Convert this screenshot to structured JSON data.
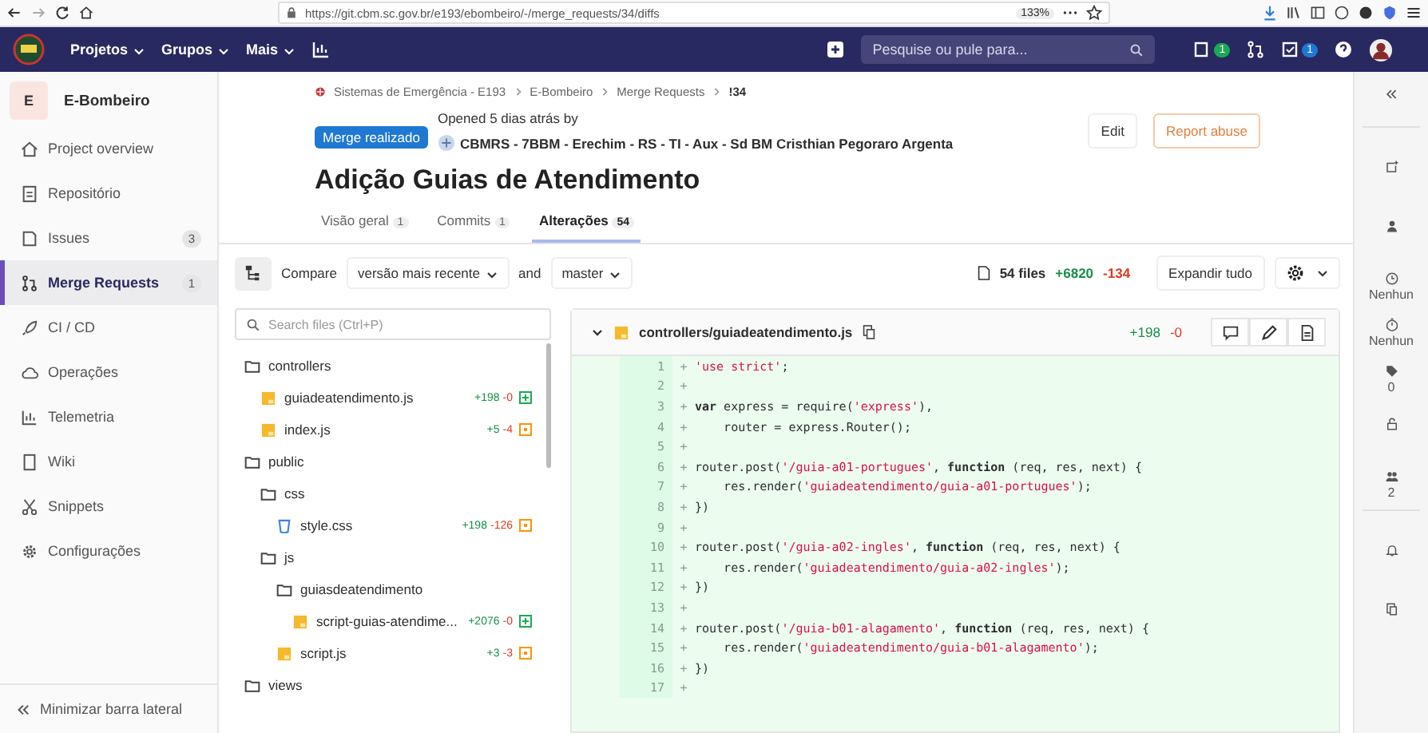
{
  "browser": {
    "url": "https://git.cbm.sc.gov.br/e193/ebombeiro/-/merge_requests/34/diffs",
    "zoom": "133%"
  },
  "navbar": {
    "menus": [
      "Projetos",
      "Grupos",
      "Mais"
    ],
    "search_placeholder": "Pesquise ou pule para...",
    "issues_count": "1",
    "todos_count": "1"
  },
  "sidebar": {
    "project_letter": "E",
    "project_name": "E-Bombeiro",
    "items": [
      {
        "label": "Project overview",
        "selected": false
      },
      {
        "label": "Repositório",
        "selected": false
      },
      {
        "label": "Issues",
        "count": "3",
        "selected": false
      },
      {
        "label": "Merge Requests",
        "count": "1",
        "selected": true
      },
      {
        "label": "CI / CD",
        "selected": false
      },
      {
        "label": "Operações",
        "selected": false
      },
      {
        "label": "Telemetria",
        "selected": false
      },
      {
        "label": "Wiki",
        "selected": false
      },
      {
        "label": "Snippets",
        "selected": false
      },
      {
        "label": "Configurações",
        "selected": false
      }
    ],
    "collapse_label": "Minimizar barra lateral"
  },
  "breadcrumb": [
    "Sistemas de Emergência - E193",
    "E-Bombeiro",
    "Merge Requests",
    "!34"
  ],
  "merge_request": {
    "status": "Merge realizado",
    "opened": "Opened 5 dias atrás by",
    "author": "CBMRS - 7BBM - Erechim - RS - TI - Aux - Sd BM Cristhian Pegoraro Argenta",
    "title": "Adição Guias de Atendimento",
    "actions": [
      {
        "label": "Edit",
        "kind": "default"
      },
      {
        "label": "Report abuse",
        "kind": "warning"
      }
    ]
  },
  "tabs": [
    {
      "label": "Visão geral",
      "count": "1",
      "selected": false
    },
    {
      "label": "Commits",
      "count": "1",
      "selected": false
    },
    {
      "label": "Alterações",
      "count": "54",
      "selected": true
    }
  ],
  "compare": {
    "label": "Compare",
    "source": "versão mais recente",
    "joiner": "and",
    "target": "master"
  },
  "stats": {
    "files": "54 files",
    "added": "+6820",
    "removed": "-134"
  },
  "expand_label": "Expandir tudo",
  "file_tree": {
    "search_placeholder": "Search files (Ctrl+P)",
    "items": [
      {
        "name": "controllers",
        "kind": "folder",
        "children": [
          {
            "name": "guiadeatendimento.js",
            "kind": "js",
            "added": "+198",
            "removed": "-0",
            "new_file": true
          },
          {
            "name": "index.js",
            "kind": "js",
            "added": "+5",
            "removed": "-4",
            "new_file": false
          }
        ]
      },
      {
        "name": "public",
        "kind": "folder",
        "children": [
          {
            "name": "css",
            "kind": "folder",
            "children": [
              {
                "name": "style.css",
                "kind": "css",
                "added": "+198",
                "removed": "-126",
                "new_file": false
              }
            ]
          },
          {
            "name": "js",
            "kind": "folder",
            "children": [
              {
                "name": "guiasdeatendimento",
                "kind": "folder",
                "children": [
                  {
                    "name": "script-guias-atendime...",
                    "kind": "js",
                    "added": "+2076",
                    "removed": "-0",
                    "new_file": true
                  }
                ]
              },
              {
                "name": "script.js",
                "kind": "js",
                "added": "+3",
                "removed": "-3",
                "new_file": false
              }
            ]
          }
        ]
      },
      {
        "name": "views",
        "kind": "folder"
      }
    ]
  },
  "diff": {
    "path": "controllers/guiadeatendimento.js",
    "added": "+198",
    "removed": "-0",
    "lines": [
      {
        "num": "1",
        "marker": "+",
        "tokens": [
          {
            "kind": "string",
            "text": "'use strict'"
          },
          {
            "kind": "plain",
            "text": ";"
          }
        ]
      },
      {
        "num": "2",
        "marker": "+"
      },
      {
        "num": "3",
        "marker": "+",
        "tokens": [
          {
            "kind": "keyword",
            "text": "var"
          },
          {
            "kind": "plain",
            "text": " express = require("
          },
          {
            "kind": "string",
            "text": "'express'"
          },
          {
            "kind": "plain",
            "text": "),"
          }
        ]
      },
      {
        "num": "4",
        "marker": "+",
        "tokens": [
          {
            "kind": "plain",
            "text": "    router = express.Router();"
          }
        ]
      },
      {
        "num": "5",
        "marker": "+"
      },
      {
        "num": "6",
        "marker": "+",
        "tokens": [
          {
            "kind": "plain",
            "text": "router.post("
          },
          {
            "kind": "string",
            "text": "'/guia-a01-portugues'"
          },
          {
            "kind": "plain",
            "text": ", "
          },
          {
            "kind": "keyword",
            "text": "function"
          },
          {
            "kind": "plain",
            "text": " (req, res, next) {"
          }
        ]
      },
      {
        "num": "7",
        "marker": "+",
        "tokens": [
          {
            "kind": "plain",
            "text": "    res.render("
          },
          {
            "kind": "string",
            "text": "'guiadeatendimento/guia-a01-portugues'"
          },
          {
            "kind": "plain",
            "text": ");"
          }
        ]
      },
      {
        "num": "8",
        "marker": "+",
        "tokens": [
          {
            "kind": "plain",
            "text": "})"
          }
        ]
      },
      {
        "num": "9",
        "marker": "+"
      },
      {
        "num": "10",
        "marker": "+",
        "tokens": [
          {
            "kind": "plain",
            "text": "router.post("
          },
          {
            "kind": "string",
            "text": "'/guia-a02-ingles'"
          },
          {
            "kind": "plain",
            "text": ", "
          },
          {
            "kind": "keyword",
            "text": "function"
          },
          {
            "kind": "plain",
            "text": " (req, res, next) {"
          }
        ]
      },
      {
        "num": "11",
        "marker": "+",
        "tokens": [
          {
            "kind": "plain",
            "text": "    res.render("
          },
          {
            "kind": "string",
            "text": "'guiadeatendimento/guia-a02-ingles'"
          },
          {
            "kind": "plain",
            "text": ");"
          }
        ]
      },
      {
        "num": "12",
        "marker": "+",
        "tokens": [
          {
            "kind": "plain",
            "text": "})"
          }
        ]
      },
      {
        "num": "13",
        "marker": "+"
      },
      {
        "num": "14",
        "marker": "+",
        "tokens": [
          {
            "kind": "plain",
            "text": "router.post("
          },
          {
            "kind": "string",
            "text": "'/guia-b01-alagamento'"
          },
          {
            "kind": "plain",
            "text": ", "
          },
          {
            "kind": "keyword",
            "text": "function"
          },
          {
            "kind": "plain",
            "text": " (req, res, next) {"
          }
        ]
      },
      {
        "num": "15",
        "marker": "+",
        "tokens": [
          {
            "kind": "plain",
            "text": "    res.render("
          },
          {
            "kind": "string",
            "text": "'guiadeatendimento/guia-b01-alagamento'"
          },
          {
            "kind": "plain",
            "text": ");"
          }
        ]
      },
      {
        "num": "16",
        "marker": "+",
        "tokens": [
          {
            "kind": "plain",
            "text": "})"
          }
        ]
      },
      {
        "num": "17",
        "marker": "+"
      }
    ]
  },
  "right_sidebar": {
    "milestone": "Nenhun",
    "time_tracking": "Nenhun",
    "labels": "0",
    "participants": "2"
  }
}
